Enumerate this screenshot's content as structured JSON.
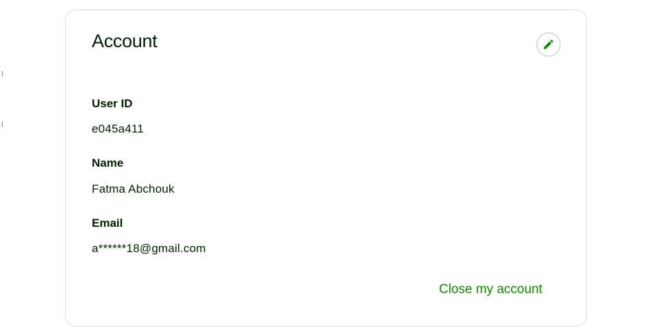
{
  "account": {
    "title": "Account",
    "edit_icon": "pencil-icon",
    "fields": [
      {
        "label": "User ID",
        "value": "e045a411"
      },
      {
        "label": "Name",
        "value": "Fatma Abchouk"
      },
      {
        "label": "Email",
        "value": "a******18@gmail.com"
      }
    ],
    "close_account_label": "Close my account"
  },
  "colors": {
    "accent": "#108a00",
    "text": "#001e00",
    "border": "#d5e0d5"
  }
}
